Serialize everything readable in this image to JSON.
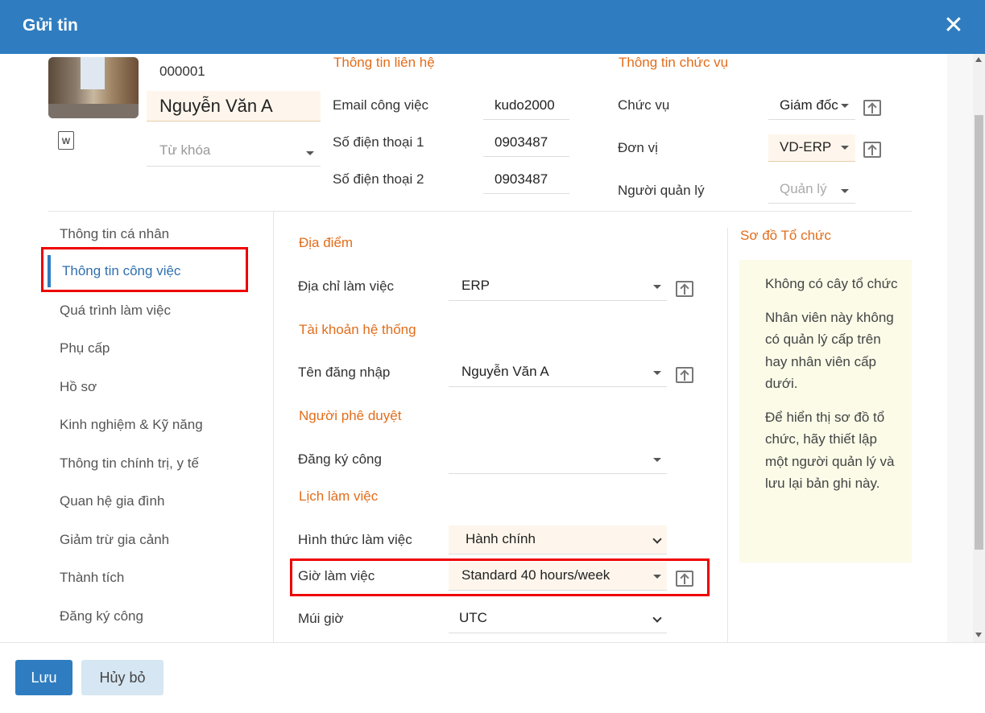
{
  "header": {
    "title": "Gửi tin",
    "close_icon": "close-icon"
  },
  "employee": {
    "code": "000001",
    "name": "Nguyễn Văn A",
    "keyword_placeholder": "Từ khóa"
  },
  "contact": {
    "title": "Thông tin liên hệ",
    "work_email_label": "Email công việc",
    "work_email_value": "kudo2000",
    "phone1_label": "Số điện thoại 1",
    "phone1_value": "0903487",
    "phone2_label": "Số điện thoại 2",
    "phone2_value": "0903487"
  },
  "position": {
    "title": "Thông tin chức vụ",
    "job_label": "Chức vụ",
    "job_value": "Giám đốc",
    "unit_label": "Đơn vị",
    "unit_value": "VD-ERP",
    "manager_label": "Người quản lý",
    "manager_placeholder": "Quản lý"
  },
  "nav": {
    "items": [
      "Thông tin cá nhân",
      "Thông tin công việc",
      "Quá trình làm việc",
      "Phụ cấp",
      "Hồ sơ",
      "Kinh nghiệm & Kỹ năng",
      "Thông tin chính trị, y tế",
      "Quan hệ gia đình",
      "Giảm trừ gia cảnh",
      "Thành tích",
      "Đăng ký công"
    ],
    "active_index": 1
  },
  "work": {
    "location_title": "Địa điểm",
    "work_address_label": "Địa chỉ làm việc",
    "work_address_value": "ERP",
    "account_title": "Tài khoản hệ thống",
    "login_label": "Tên đăng nhập",
    "login_value": "Nguyễn Văn A",
    "approver_title": "Người phê duyệt",
    "timesheet_label": "Đăng ký công",
    "timesheet_value": "",
    "schedule_title": "Lịch làm việc",
    "work_type_label": "Hình thức làm việc",
    "work_type_value": "Hành chính",
    "work_hours_label": "Giờ làm việc",
    "work_hours_value": "Standard 40 hours/week",
    "timezone_label": "Múi giờ",
    "timezone_value": "UTC"
  },
  "org": {
    "title": "Sơ đồ Tổ chức",
    "p1": "Không có cây tổ chức",
    "p2": "Nhân viên này không có quản lý cấp trên hay nhân viên cấp dưới.",
    "p3": "Để hiển thị sơ đồ tổ chức, hãy thiết lập một người quản lý và lưu lại bản ghi này."
  },
  "footer": {
    "save_label": "Lưu",
    "cancel_label": "Hủy bỏ"
  },
  "colors": {
    "header": "#2f7dc0",
    "accent": "#e26d1b",
    "highlight": "#ee0000"
  }
}
